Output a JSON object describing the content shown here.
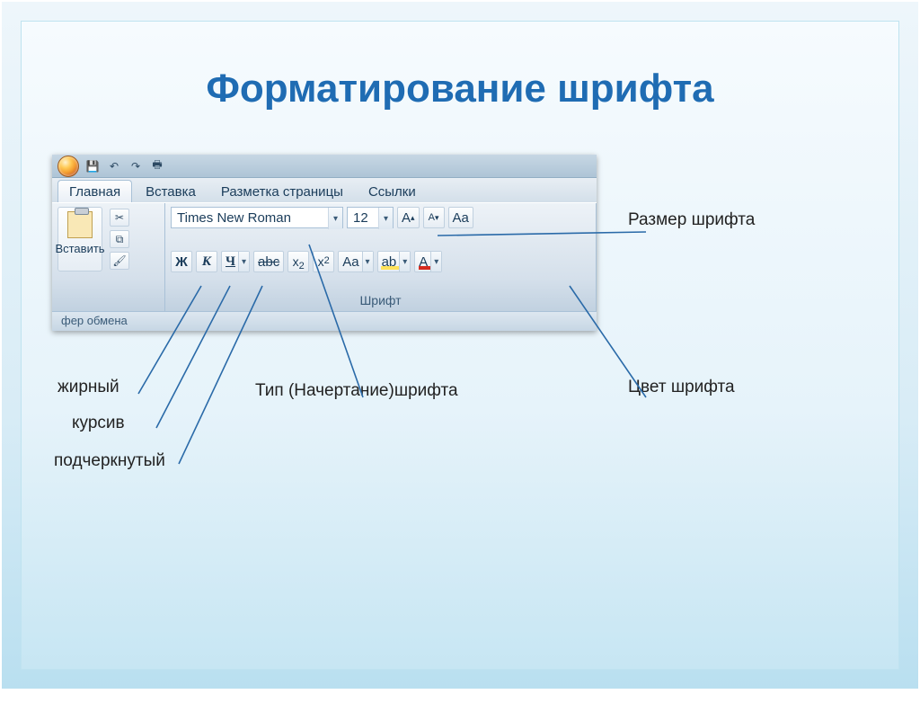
{
  "title": "Форматирование шрифта",
  "qat": {
    "save": "💾",
    "undo": "↶",
    "redo": "↷",
    "print": "🖶"
  },
  "tabs": {
    "home": "Главная",
    "insert": "Вставка",
    "layout": "Разметка страницы",
    "links": "Ссылки"
  },
  "clipboard": {
    "paste": "Вставить",
    "group_label_left": "фер обмена",
    "cut": "✂",
    "copy": "⧉",
    "painter": "🖌"
  },
  "font": {
    "group_label": "Шрифт",
    "name": "Times New Roman",
    "size": "12",
    "bold": "Ж",
    "italic": "К",
    "underline": "Ч",
    "strike": "abc",
    "case": "Aa",
    "grow": "A",
    "shrink": "A",
    "clear": "Aa",
    "highlight": "ab",
    "color": "A"
  },
  "annotations": {
    "size": "Размер шрифта",
    "color": "Цвет шрифта",
    "bold": "жирный",
    "italic": "курсив",
    "underline": "подчеркнутый",
    "face": "Тип (Начертание)шрифта"
  }
}
